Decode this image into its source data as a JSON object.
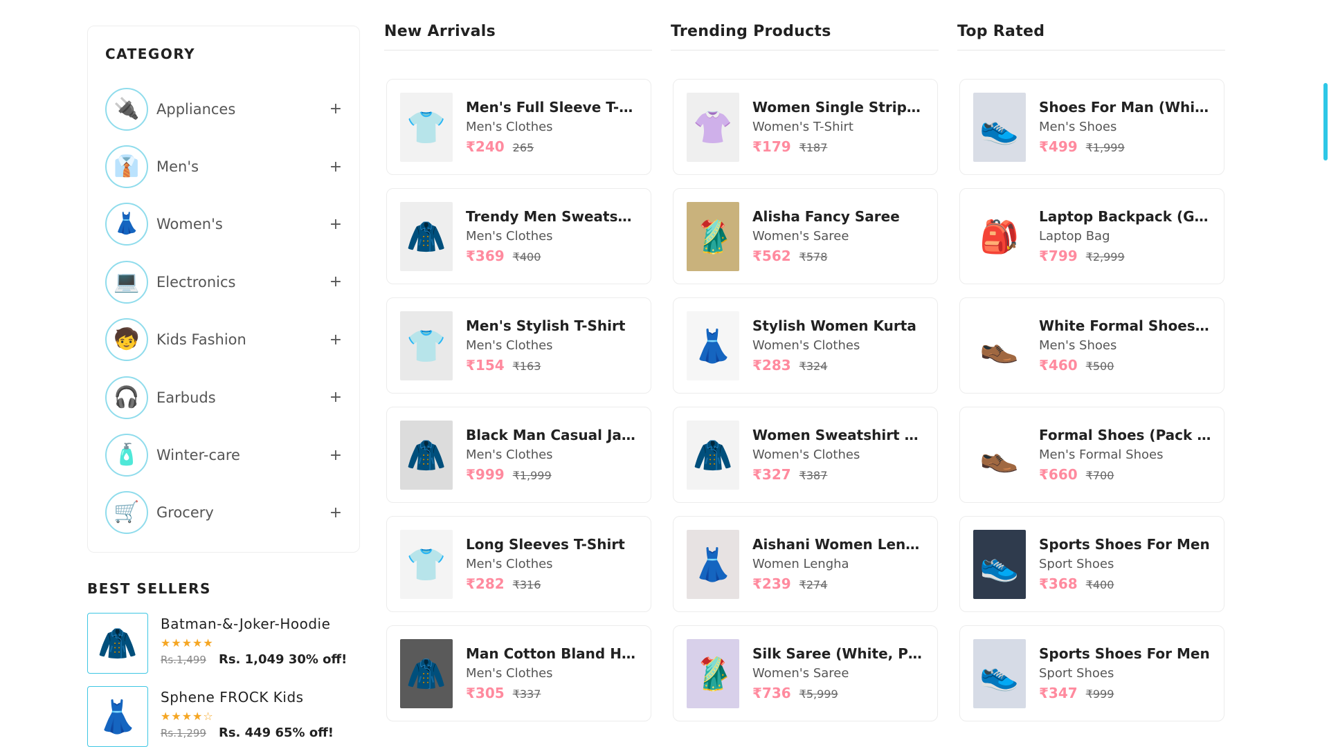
{
  "sidebar": {
    "category_title": "CATEGORY",
    "categories": [
      {
        "label": "Appliances",
        "icon": "🔌",
        "toggle": "+"
      },
      {
        "label": "Men's",
        "icon": "👔",
        "toggle": "+"
      },
      {
        "label": "Women's",
        "icon": "👗",
        "toggle": "+"
      },
      {
        "label": "Electronics",
        "icon": "💻",
        "toggle": "+"
      },
      {
        "label": "Kids Fashion",
        "icon": "🧒",
        "toggle": "+"
      },
      {
        "label": "Earbuds",
        "icon": "🎧",
        "toggle": "+"
      },
      {
        "label": "Winter-care",
        "icon": "🧴",
        "toggle": "+"
      },
      {
        "label": "Grocery",
        "icon": "🛒",
        "toggle": "+"
      }
    ],
    "best_sellers_title": "BEST SELLERS",
    "best_sellers": [
      {
        "name": "Batman-&-Joker-Hoodie",
        "stars": "★★★★★",
        "old_price": "Rs.1,499",
        "new_price": "Rs. 1,049 30% off!",
        "icon": "🧥"
      },
      {
        "name": "Sphene FROCK Kids",
        "stars": "★★★★☆",
        "old_price": "Rs.1,299",
        "new_price": "Rs. 449 65% off!",
        "icon": "👗"
      }
    ]
  },
  "columns": [
    {
      "title": "New Arrivals",
      "products": [
        {
          "title": "Men's Full Sleeve T-Shi...",
          "category": "Men's Clothes",
          "price": "₹240",
          "old_price": "265",
          "icon": "👕",
          "bg": "#f2f2f2"
        },
        {
          "title": "Trendy Men Sweatshirt",
          "category": "Men's Clothes",
          "price": "₹369",
          "old_price": "₹400",
          "icon": "🧥",
          "bg": "#eeeeee"
        },
        {
          "title": "Men's Stylish T-Shirt",
          "category": "Men's Clothes",
          "price": "₹154",
          "old_price": "₹163",
          "icon": "👕",
          "bg": "#e9e9e9"
        },
        {
          "title": "Black Man Casual Jac...",
          "category": "Men's Clothes",
          "price": "₹999",
          "old_price": "₹1,999",
          "icon": "🧥",
          "bg": "#dcdcdc"
        },
        {
          "title": "Long Sleeves T-Shirt",
          "category": "Men's Clothes",
          "price": "₹282",
          "old_price": "₹316",
          "icon": "👕",
          "bg": "#f4f4f4"
        },
        {
          "title": "Man Cotton Bland Hoo...",
          "category": "Men's Clothes",
          "price": "₹305",
          "old_price": "₹337",
          "icon": "🧥",
          "bg": "#5a5a5a"
        }
      ]
    },
    {
      "title": "Trending Products",
      "products": [
        {
          "title": "Women Single Stripe T...",
          "category": "Women's T-Shirt",
          "price": "₹179",
          "old_price": "₹187",
          "icon": "👚",
          "bg": "#efefef"
        },
        {
          "title": "Alisha Fancy Saree",
          "category": "Women's Saree",
          "price": "₹562",
          "old_price": "₹578",
          "icon": "🥻",
          "bg": "#c9b27c"
        },
        {
          "title": "Stylish Women Kurta",
          "category": "Women's Clothes",
          "price": "₹283",
          "old_price": "₹324",
          "icon": "👗",
          "bg": "#f6f6f6"
        },
        {
          "title": "Women Sweatshirt Fo...",
          "category": "Women's Clothes",
          "price": "₹327",
          "old_price": "₹387",
          "icon": "🧥",
          "bg": "#f3f3f3"
        },
        {
          "title": "Aishani Women Lengha",
          "category": "Women Lengha",
          "price": "₹239",
          "old_price": "₹274",
          "icon": "👗",
          "bg": "#e7e2e2"
        },
        {
          "title": "Silk Saree (White, Pink)",
          "category": "Women's Saree",
          "price": "₹736",
          "old_price": "₹5,999",
          "icon": "🥻",
          "bg": "#d8d0ea"
        }
      ]
    },
    {
      "title": "Top Rated",
      "products": [
        {
          "title": "Shoes For Man (White,...",
          "category": "Men's Shoes",
          "price": "₹499",
          "old_price": "₹1,999",
          "icon": "👟",
          "bg": "#d9dde6"
        },
        {
          "title": "Laptop Backpack (Gre...",
          "category": "Laptop Bag",
          "price": "₹799",
          "old_price": "₹2,999",
          "icon": "🎒",
          "bg": "#ffffff"
        },
        {
          "title": "White Formal Shoes F...",
          "category": "Men's Shoes",
          "price": "₹460",
          "old_price": "₹500",
          "icon": "👞",
          "bg": "#ffffff"
        },
        {
          "title": "Formal Shoes (Pack O...",
          "category": "Men's Formal Shoes",
          "price": "₹660",
          "old_price": "₹700",
          "icon": "👞",
          "bg": "#ffffff"
        },
        {
          "title": "Sports Shoes For Men",
          "category": "Sport Shoes",
          "price": "₹368",
          "old_price": "₹400",
          "icon": "👟",
          "bg": "#2f3b4d"
        },
        {
          "title": "Sports Shoes For Men",
          "category": "Sport Shoes",
          "price": "₹347",
          "old_price": "₹999",
          "icon": "👟",
          "bg": "#d6dbe6"
        }
      ]
    }
  ]
}
